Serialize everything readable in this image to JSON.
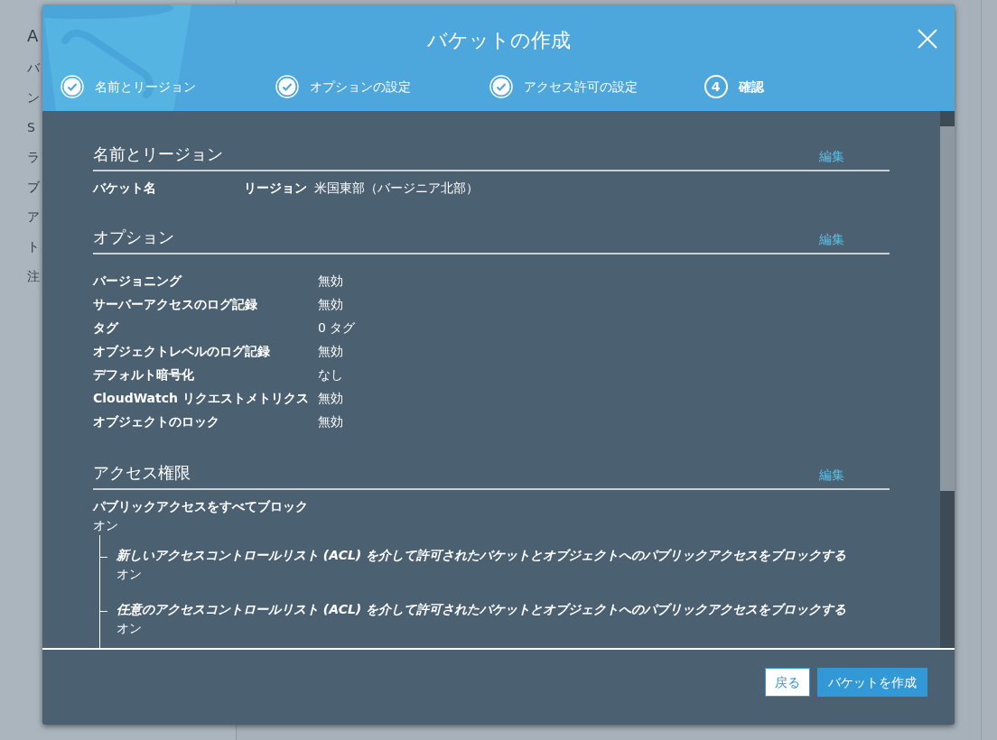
{
  "background_page": {
    "fragments": [
      "A",
      "バ",
      "ン",
      "S",
      "ラ",
      "ブ",
      "ア",
      "ト",
      "注"
    ]
  },
  "dialog": {
    "title": "バケットの作成",
    "steps": [
      {
        "label": "名前とリージョン",
        "done": true,
        "selected": false
      },
      {
        "label": "オプションの設定",
        "done": true,
        "selected": false
      },
      {
        "label": "アクセス許可の設定",
        "done": true,
        "selected": false
      },
      {
        "label": "確認",
        "number": "4",
        "done": false,
        "selected": true
      }
    ],
    "sections": [
      {
        "title": "名前とリージョン",
        "edit": "編集",
        "kind": "inline",
        "fields": [
          {
            "label": "バケット名"
          },
          {
            "label": "リージョン",
            "value": "米国東部（バージニア北部）"
          }
        ]
      },
      {
        "title": "オプション",
        "edit": "編集",
        "kind": "table",
        "rows": [
          {
            "label": "バージョニング",
            "value": "無効"
          },
          {
            "label": "サーバーアクセスのログ記録",
            "value": "無効"
          },
          {
            "label": "タグ",
            "value": "0 タグ"
          },
          {
            "label": "オブジェクトレベルのログ記録",
            "value": "無効"
          },
          {
            "label": "デフォルト暗号化",
            "value": "なし"
          },
          {
            "label": "CloudWatch リクエストメトリクス",
            "value": "無効"
          },
          {
            "label": "オブジェクトのロック",
            "value": "無効"
          }
        ]
      },
      {
        "title": "アクセス権限",
        "edit": "編集",
        "kind": "tree",
        "tree": {
          "label": "パブリックアクセスをすべてブロック",
          "value": "オン",
          "children": [
            {
              "label": "新しいアクセスコントロールリスト (ACL) を介して許可されたバケットとオブジェクトへのパブリックアクセスをブロックする",
              "value": "オン"
            },
            {
              "label": "任意のアクセスコントロールリスト (ACL) を介して許可されたバケットとオブジェクトへのパブリックアクセスをブロックする",
              "value": "オン"
            }
          ]
        }
      }
    ],
    "buttons": [
      {
        "label": "戻る",
        "kind": "secondary"
      },
      {
        "label": "バケットを作成",
        "kind": "primary"
      }
    ]
  }
}
